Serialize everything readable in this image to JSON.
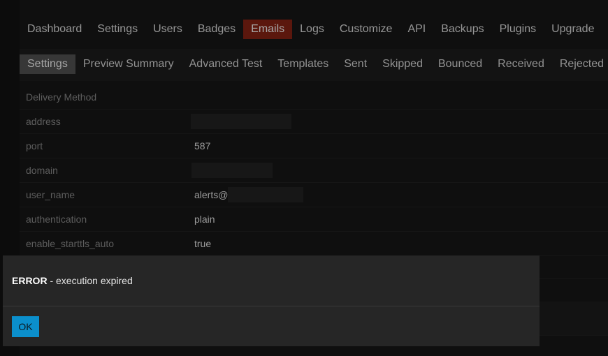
{
  "main_nav": {
    "items": [
      "Dashboard",
      "Settings",
      "Users",
      "Badges",
      "Emails",
      "Logs",
      "Customize",
      "API",
      "Backups",
      "Plugins",
      "Upgrade"
    ],
    "active": "Emails"
  },
  "sub_nav": {
    "items": [
      "Settings",
      "Preview Summary",
      "Advanced Test",
      "Templates",
      "Sent",
      "Skipped",
      "Bounced",
      "Received",
      "Rejected"
    ],
    "active": "Settings"
  },
  "settings_table": {
    "section_title": "Delivery Method",
    "rows": [
      {
        "label": "address",
        "value": ""
      },
      {
        "label": "port",
        "value": "587"
      },
      {
        "label": "domain",
        "value": ""
      },
      {
        "label": "user_name",
        "value": "alerts@"
      },
      {
        "label": "authentication",
        "value": "plain"
      },
      {
        "label": "enable_starttls_auto",
        "value": "true"
      }
    ]
  },
  "error_modal": {
    "title": "ERROR",
    "message": " - execution expired",
    "ok_label": "OK"
  },
  "colors": {
    "active_main_tab": "#7a1f12",
    "active_sub_tab": "#4a4a4a",
    "ok_button": "#0b8fcc"
  }
}
